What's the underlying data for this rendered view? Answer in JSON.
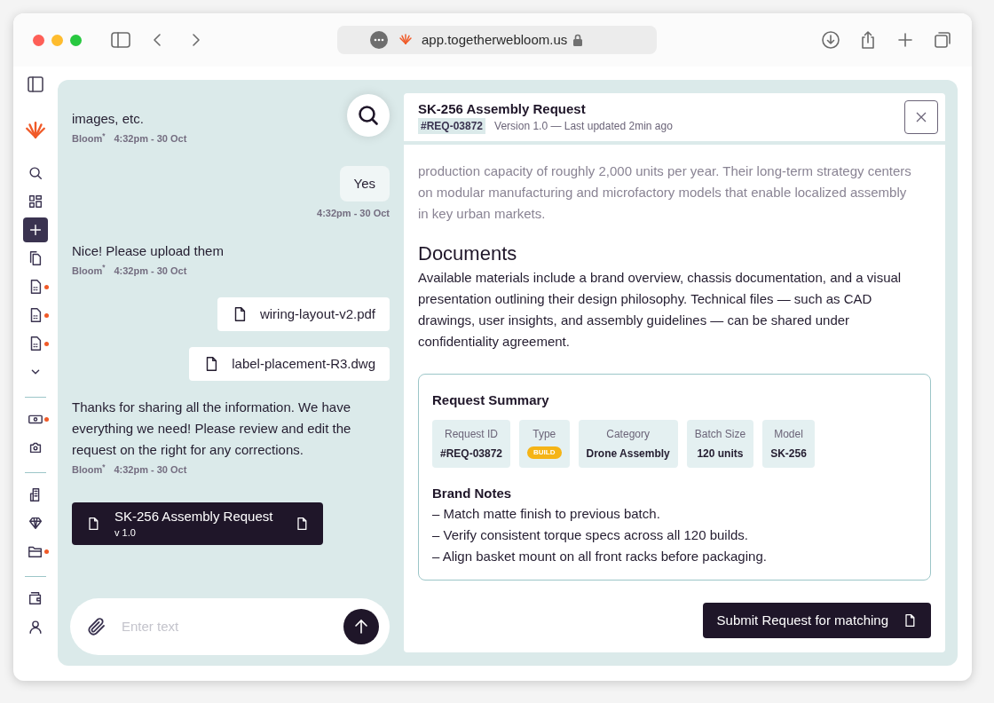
{
  "browser": {
    "url": "app.togetherwebloom.us"
  },
  "sidebar": {
    "groups": [
      {
        "items": [
          {
            "selected": false,
            "dot": false
          },
          {
            "selected": false,
            "dot": false
          },
          {
            "selected": true,
            "dot": false
          },
          {
            "selected": false,
            "dot": false
          },
          {
            "selected": false,
            "dot": true
          },
          {
            "selected": false,
            "dot": true
          },
          {
            "selected": false,
            "dot": true
          },
          {
            "selected": false,
            "dot": false
          }
        ]
      },
      {
        "items": [
          {
            "selected": false,
            "dot": true
          },
          {
            "selected": false,
            "dot": false
          }
        ]
      },
      {
        "items": [
          {
            "selected": false,
            "dot": false
          },
          {
            "selected": false,
            "dot": false
          },
          {
            "selected": false,
            "dot": true
          }
        ]
      },
      {
        "items": [
          {
            "selected": false,
            "dot": false
          },
          {
            "selected": false,
            "dot": false
          }
        ]
      }
    ]
  },
  "chat": {
    "messages": [
      {
        "kind": "bot",
        "text": "images, etc.",
        "sender": "Bloom$^{*}$",
        "time": "4:32pm - 30 Oct"
      },
      {
        "kind": "user",
        "text": "Yes",
        "time": "4:32pm - 30 Oct"
      },
      {
        "kind": "bot",
        "text": "Nice! Please upload them",
        "sender": "Bloom$^{*}$",
        "time": "4:32pm - 30 Oct"
      },
      {
        "kind": "file",
        "name": "wiring-layout-v2.pdf"
      },
      {
        "kind": "file",
        "name": "label-placement-R3.dwg"
      },
      {
        "kind": "bot",
        "text": "Thanks for sharing all the information. We have everything we need! Please review and edit the request on the right for any corrections.",
        "sender": "Bloom$^{*}$",
        "time": "4:32pm - 30 Oct"
      },
      {
        "kind": "document",
        "title": "SK-256 Assembly Request",
        "version": "v 1.0"
      }
    ],
    "input": {
      "placeholder": "Enter text"
    }
  },
  "request": {
    "title": "SK-256 Assembly Request",
    "id_tag": "#REQ-03872",
    "meta": "Version 1.0 — Last updated 2min ago",
    "intro": "production capacity of roughly 2,000 units per year. Their long-term strategy centers on modular manufacturing and microfactory models that enable localized assembly in key urban markets.",
    "documents_heading": "Documents",
    "documents_text": "Available materials include a brand overview, chassis documentation, and a visual presentation outlining their design philosophy. Technical files — such as CAD drawings, user insights, and assembly guidelines — can be shared under confidentiality agreement.",
    "summary": {
      "title": "Request Summary",
      "fields": [
        {
          "label": "Request ID",
          "value": "#REQ-03872",
          "kind": "text"
        },
        {
          "label": "Type",
          "value": "BUILD",
          "kind": "badge"
        },
        {
          "label": "Category",
          "value": "Drone Assembly",
          "kind": "text"
        },
        {
          "label": "Batch Size",
          "value": "120 units",
          "kind": "text"
        },
        {
          "label": "Model",
          "value": "SK-256",
          "kind": "text"
        }
      ],
      "notes_title": "Brand Notes",
      "notes": [
        "– Match matte finish to previous batch.",
        "– Verify consistent torque specs across all 120 builds.",
        "– Align basket mount on all front racks before packaging."
      ]
    },
    "submit_label": "Submit Request for matching"
  }
}
